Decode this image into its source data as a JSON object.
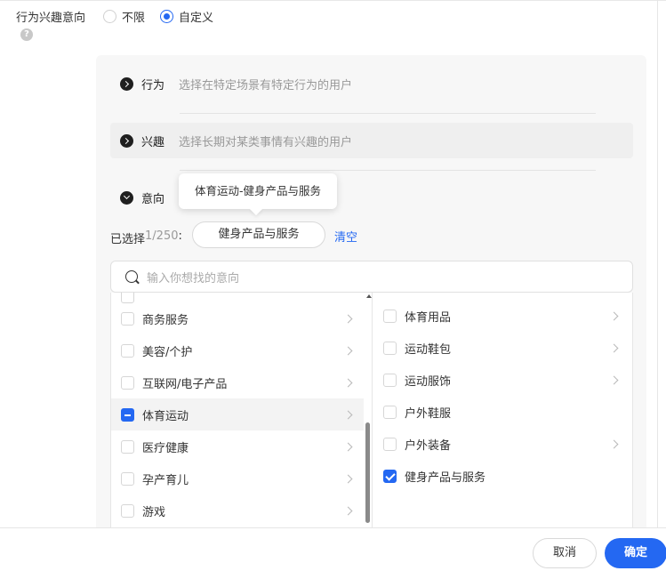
{
  "field": {
    "label": "行为兴趣意向",
    "help_glyph": "?"
  },
  "radios": [
    {
      "label": "不限",
      "selected": false
    },
    {
      "label": "自定义",
      "selected": true
    }
  ],
  "categories": [
    {
      "title": "行为",
      "desc": "选择在特定场景有特定行为的用户",
      "expanded": false
    },
    {
      "title": "兴趣",
      "desc": "选择长期对某类事情有兴趣的用户",
      "expanded": false
    },
    {
      "title": "意向",
      "desc": "",
      "expanded": true
    }
  ],
  "tooltip": {
    "text": "体育运动-健身产品与服务"
  },
  "selection": {
    "label": "已选择",
    "count": "1/250",
    "colon": ":",
    "tag": "健身产品与服务",
    "clear": "清空"
  },
  "search": {
    "placeholder": "输入你想找的意向"
  },
  "left_list": [
    {
      "label": "商务服务",
      "state": "unchecked",
      "has_children": true
    },
    {
      "label": "美容/个护",
      "state": "unchecked",
      "has_children": true
    },
    {
      "label": "互联网/电子产品",
      "state": "unchecked",
      "has_children": true
    },
    {
      "label": "体育运动",
      "state": "partial",
      "has_children": true,
      "active": true
    },
    {
      "label": "医疗健康",
      "state": "unchecked",
      "has_children": true
    },
    {
      "label": "孕产育儿",
      "state": "unchecked",
      "has_children": true
    },
    {
      "label": "游戏",
      "state": "unchecked",
      "has_children": true
    }
  ],
  "right_list": [
    {
      "label": "体育用品",
      "state": "unchecked",
      "has_children": true
    },
    {
      "label": "运动鞋包",
      "state": "unchecked",
      "has_children": true
    },
    {
      "label": "运动服饰",
      "state": "unchecked",
      "has_children": true
    },
    {
      "label": "户外鞋服",
      "state": "unchecked",
      "has_children": false
    },
    {
      "label": "户外装备",
      "state": "unchecked",
      "has_children": true
    },
    {
      "label": "健身产品与服务",
      "state": "checked",
      "has_children": false
    }
  ],
  "footer": {
    "cancel": "取消",
    "confirm": "确定"
  },
  "colors": {
    "accent": "#2468f2",
    "muted": "#999999",
    "panel_bg": "#f7f7f7"
  }
}
